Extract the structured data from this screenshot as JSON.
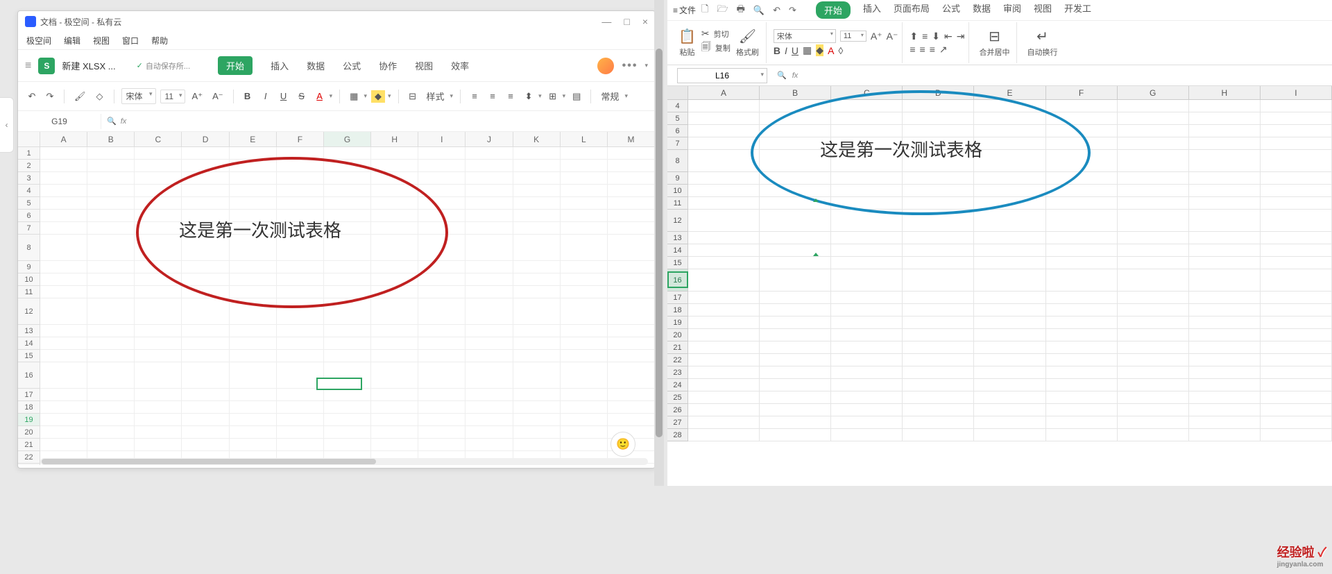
{
  "left": {
    "title": "文档 - 极空间 - 私有云",
    "win": {
      "min": "—",
      "max": "□",
      "close": "×"
    },
    "menus": [
      "极空间",
      "编辑",
      "视图",
      "窗口",
      "帮助"
    ],
    "sheet_badge": "S",
    "tab_name": "新建 XLSX ...",
    "autosave": "自动保存所...",
    "doc_tabs": [
      "开始",
      "插入",
      "数据",
      "公式",
      "协作",
      "视图",
      "效率"
    ],
    "toolbar": {
      "font": "宋体",
      "size": "11",
      "style_label": "样式",
      "general": "常规"
    },
    "namebox": "G19",
    "fx": "fx",
    "columns": [
      "A",
      "B",
      "C",
      "D",
      "E",
      "F",
      "G",
      "H",
      "I",
      "J",
      "K",
      "L",
      "M"
    ],
    "big_text": "这是第一次测试表格",
    "sidebar_hint": "‹"
  },
  "right": {
    "file": "文件",
    "tabs": [
      "开始",
      "插入",
      "页面布局",
      "公式",
      "数据",
      "审阅",
      "视图",
      "开发工"
    ],
    "ribbon": {
      "paste": "粘贴",
      "cut": "剪切",
      "copy": "复制",
      "fmt": "格式刷",
      "font": "宋体",
      "size": "11",
      "merge": "合并居中",
      "autowrap": "自动换行"
    },
    "namebox": "L16",
    "fx": "fx",
    "columns": [
      "A",
      "B",
      "C",
      "D",
      "E",
      "F",
      "G",
      "H",
      "I"
    ],
    "big_text": "这是第一次测试表格"
  },
  "watermark": {
    "main": "经验啦",
    "chk": "✓",
    "sub": "jingyanla.com"
  }
}
